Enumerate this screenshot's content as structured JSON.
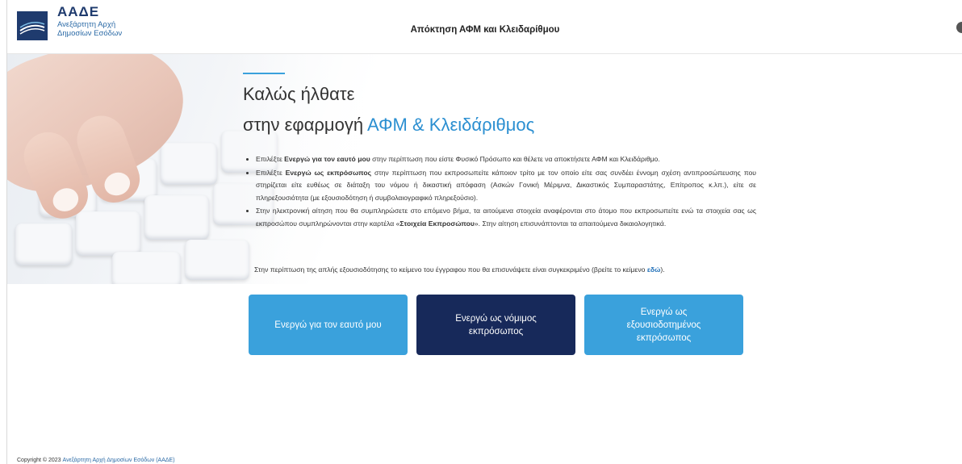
{
  "header": {
    "logo_title": "ΑΑΔΕ",
    "logo_sub_1": "Ανεξάρτητη Αρχή",
    "logo_sub_2": "Δημοσίων Εσόδων",
    "title": "Απόκτηση ΑΦΜ και Κλειδαρίθμου"
  },
  "welcome": {
    "line1": "Καλώς ήλθατε",
    "line2_prefix": "στην εφαρμογή ",
    "line2_highlight": "ΑΦΜ & Κλειδάριθμος"
  },
  "bullets": {
    "b1_pre": "Επιλέξτε ",
    "b1_bold": "Ενεργώ για τον εαυτό μου",
    "b1_post": " στην περίπτωση που είστε Φυσικό Πρόσωπο και θέλετε να αποκτήσετε ΑΦΜ και Κλειδάριθμο.",
    "b2_pre": "Επιλέξτε ",
    "b2_bold": "Ενεργώ ως εκπρόσωπος",
    "b2_post": " στην περίπτωση που εκπροσωπείτε κάποιον τρίτο με τον οποίο είτε σας συνδέει έννομη σχέση αντιπροσώπευσης που στηρίζεται είτε ευθέως σε διάταξη του νόμου ή δικαστική απόφαση (Ασκών Γονική Μέριμνα, Δικαστικός Συμπαραστάτης, Επίτροπος κ.λπ.), είτε σε πληρεξουσιότητα (με εξουσιοδότηση ή συμβολαιογραφικό πληρεξούσιο).",
    "b3_pre": "Στην ηλεκτρονική αίτηση που θα συμπληρώσετε στο επόμενο βήμα, τα αιτούμενα στοιχεία αναφέρονται στο άτομο που εκπροσωπείτε ενώ τα στοιχεία σας ως εκπροσώπου συμπληρώνονται στην καρτέλα «",
    "b3_bold": "Στοιχεία Εκπροσώπου",
    "b3_post": "». Στην αίτηση επισυνάπτονται τα απαιτούμενα δικαιολογητικά."
  },
  "note": {
    "text": "Στην περίπτωση της απλής εξουσιοδότησης το κείμενο του έγγραφου που θα επισυνάψετε είναι συγκεκριμένο (βρείτε το κείμενο ",
    "link": "εδώ",
    "end": ")."
  },
  "buttons": {
    "self": "Ενεργώ για τον εαυτό μου",
    "legal": "Ενεργώ ως νόμιμος εκπρόσωπος",
    "authorized": "Ενεργώ ως εξουσιοδοτημένος εκπρόσωπος"
  },
  "footer": {
    "prefix": "Copyright © 2023 ",
    "link": "Ανεξάρτητη Αρχή Δημοσίων Εσόδων (ΑΑΔΕ)"
  },
  "colors": {
    "accent": "#3aa1dc",
    "dark_button": "#17295a",
    "brand": "#1f3b6e"
  }
}
